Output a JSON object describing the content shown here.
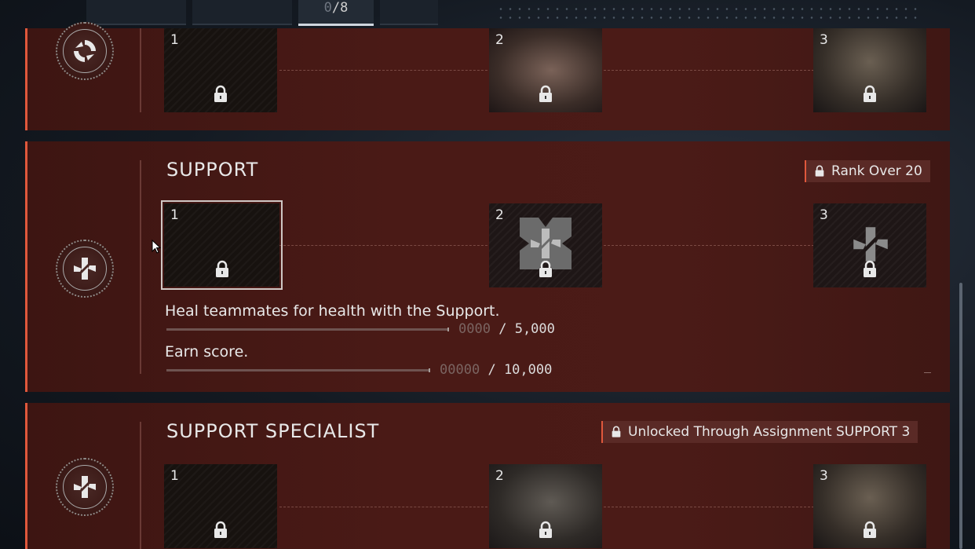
{
  "topbar": {
    "counter_dim": "0",
    "counter_rest": "/8"
  },
  "panels": {
    "top": {
      "slots": [
        {
          "num": "1"
        },
        {
          "num": "2"
        },
        {
          "num": "3"
        }
      ]
    },
    "support": {
      "title": "SUPPORT",
      "lock_label": "Rank Over 20",
      "slots": [
        {
          "num": "1"
        },
        {
          "num": "2"
        },
        {
          "num": "3"
        }
      ],
      "tasks": [
        {
          "text": "Heal teammates for health with the Support.",
          "current": "0000",
          "sep": "/",
          "target": "5,000",
          "progress": 0
        },
        {
          "text": "Earn score.",
          "current": "00000",
          "sep": "/",
          "target": "10,000",
          "progress": 0
        }
      ]
    },
    "support_specialist": {
      "title": "SUPPORT SPECIALIST",
      "lock_label": "Unlocked Through Assignment SUPPORT 3",
      "slots": [
        {
          "num": "1"
        },
        {
          "num": "2"
        },
        {
          "num": "3"
        }
      ]
    }
  },
  "icons": {
    "lock": "lock-icon",
    "badge_top": "recon-class-icon",
    "badge_support": "support-class-icon",
    "cursor": "mouse-cursor-icon"
  },
  "colors": {
    "accent": "#e0583c",
    "panel": "#4a1a16"
  }
}
